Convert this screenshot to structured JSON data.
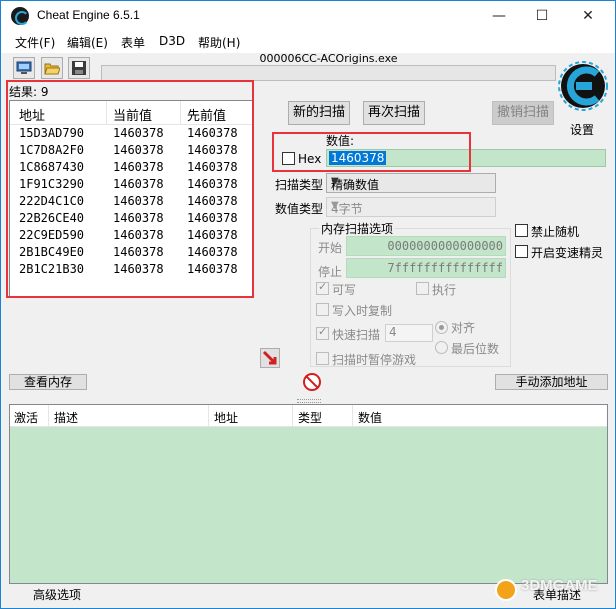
{
  "window": {
    "title": "Cheat Engine 6.5.1",
    "minimize": "—",
    "maximize": "☐",
    "close": "✕"
  },
  "menu": [
    "文件(F)",
    "编辑(E)",
    "表单",
    "D3D",
    "帮助(H)"
  ],
  "process": {
    "name": "000006CC-ACOrigins.exe",
    "progress_percent": 0
  },
  "logo": {
    "label": "设置"
  },
  "results": {
    "label": "结果: 9",
    "columns": [
      "地址",
      "当前值",
      "先前值"
    ],
    "rows": [
      [
        "15D3AD790",
        "1460378",
        "1460378"
      ],
      [
        "1C7D8A2F0",
        "1460378",
        "1460378"
      ],
      [
        "1C8687430",
        "1460378",
        "1460378"
      ],
      [
        "1F91C3290",
        "1460378",
        "1460378"
      ],
      [
        "222D4C1C0",
        "1460378",
        "1460378"
      ],
      [
        "22B26CE40",
        "1460378",
        "1460378"
      ],
      [
        "22C9ED590",
        "1460378",
        "1460378"
      ],
      [
        "2B1BC49E0",
        "1460378",
        "1460378"
      ],
      [
        "2B1C21B30",
        "1460378",
        "1460378"
      ]
    ]
  },
  "scan": {
    "new_scan": "新的扫描",
    "next_scan": "再次扫描",
    "undo_scan": "撤销扫描",
    "value_label": "数值:",
    "hex_label": "Hex",
    "value": "1460378",
    "scan_type_label": "扫描类型",
    "scan_type": "精确数值",
    "value_type_label": "数值类型",
    "value_type": "4字节"
  },
  "memory_options": {
    "title": "内存扫描选项",
    "start_label": "开始",
    "start_value": "0000000000000000",
    "stop_label": "停止",
    "stop_value": "7fffffffffffffff",
    "writable": "可写",
    "executable": "执行",
    "copy_on_write": "写入时复制",
    "fast_scan": "快速扫描",
    "fast_scan_value": "4",
    "alignment": "对齐",
    "last_digits": "最后位数",
    "pause_game": "扫描时暂停游戏"
  },
  "right_options": {
    "disable_random": "禁止随机",
    "speedhack": "开启变速精灵"
  },
  "buttons": {
    "view_memory": "查看内存",
    "add_address": "手动添加地址"
  },
  "address_list": {
    "columns": [
      "激活",
      "描述",
      "地址",
      "类型",
      "数值"
    ]
  },
  "status": {
    "advanced": "高级选项",
    "table_extras": "表单描述"
  },
  "watermark": "3DMGAME"
}
